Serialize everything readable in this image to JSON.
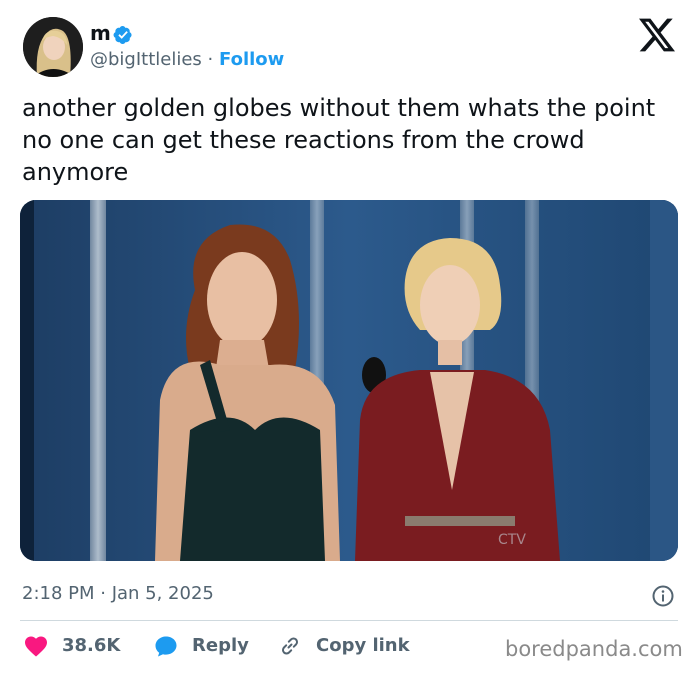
{
  "author": {
    "display_name": "m",
    "handle": "@bigIttlelies",
    "separator": "·",
    "follow_label": "Follow",
    "verified": true
  },
  "tweet": {
    "text": "another golden globes without them whats the point no one can get these reactions from the crowd anymore",
    "media_caption_watermark": "CTV"
  },
  "meta": {
    "timestamp": "2:18 PM · Jan 5, 2025"
  },
  "actions": {
    "likes": "38.6K",
    "reply_label": "Reply",
    "copy_label": "Copy link"
  },
  "watermark": "boredpanda.com",
  "colors": {
    "accent": "#1d9bf0",
    "like": "#f91880",
    "text": "#0f1419",
    "muted": "#536471",
    "divider": "#cfd9de"
  },
  "icons": [
    "verified-badge-icon",
    "x-logo-icon",
    "info-icon",
    "heart-icon",
    "reply-bubble-icon",
    "link-icon"
  ]
}
